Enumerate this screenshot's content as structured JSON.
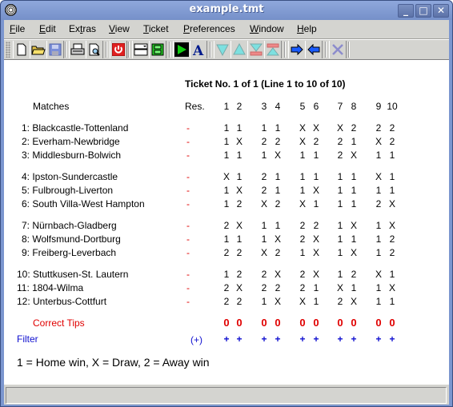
{
  "window": {
    "title": "example.tmt",
    "minimize": "_",
    "maximize": "□",
    "close": "✕"
  },
  "menu": [
    "File",
    "Edit",
    "Extras",
    "View",
    "Ticket",
    "Preferences",
    "Window",
    "Help"
  ],
  "menu_mnemonics": [
    "F",
    "E",
    "t",
    "V",
    "T",
    "P",
    "W",
    "H"
  ],
  "toolbar": [
    {
      "name": "new-document-icon"
    },
    {
      "name": "open-folder-icon"
    },
    {
      "name": "save-disk-icon"
    },
    {
      "name": "print-icon"
    },
    {
      "name": "print-preview-icon"
    },
    {
      "name": "power-exit-icon"
    },
    {
      "name": "window-dropdown-icon"
    },
    {
      "name": "film-frame-icon"
    },
    {
      "name": "play-evaluate-icon"
    },
    {
      "name": "font-a-icon"
    },
    {
      "name": "triangle-down-icon"
    },
    {
      "name": "triangle-up-icon"
    },
    {
      "name": "move-bottom-icon"
    },
    {
      "name": "move-top-icon"
    },
    {
      "name": "arrow-right-icon"
    },
    {
      "name": "arrow-left-icon"
    },
    {
      "name": "delete-x-icon"
    }
  ],
  "ticket": {
    "heading": "Ticket No. 1 of 1 (Line 1 to 10 of 10)",
    "matches_header": "Matches",
    "res_header": "Res.",
    "columns": [
      "1",
      "2",
      "3",
      "4",
      "5",
      "6",
      "7",
      "8",
      "9",
      "10"
    ],
    "matches": [
      {
        "label": "1: Blackcastle-Tottenland",
        "res": "-",
        "tips": [
          "1",
          "1",
          "1",
          "1",
          "X",
          "X",
          "X",
          "2",
          "2",
          "2"
        ]
      },
      {
        "label": "2: Everham-Newbridge",
        "res": "-",
        "tips": [
          "1",
          "X",
          "2",
          "2",
          "X",
          "2",
          "2",
          "1",
          "X",
          "2"
        ]
      },
      {
        "label": "3: Middlesburn-Bolwich",
        "res": "-",
        "tips": [
          "1",
          "1",
          "1",
          "X",
          "1",
          "1",
          "2",
          "X",
          "1",
          "1"
        ]
      },
      {
        "label": "4: Ipston-Sundercastle",
        "res": "-",
        "tips": [
          "X",
          "1",
          "2",
          "1",
          "1",
          "1",
          "1",
          "1",
          "X",
          "1"
        ]
      },
      {
        "label": "5: Fulbrough-Liverton",
        "res": "-",
        "tips": [
          "1",
          "X",
          "2",
          "1",
          "1",
          "X",
          "1",
          "1",
          "1",
          "1"
        ]
      },
      {
        "label": "6: South Villa-West Hampton",
        "res": "-",
        "tips": [
          "1",
          "2",
          "X",
          "2",
          "X",
          "1",
          "1",
          "1",
          "2",
          "X"
        ]
      },
      {
        "label": "7: Nürnbach-Gladberg",
        "res": "-",
        "tips": [
          "2",
          "X",
          "1",
          "1",
          "2",
          "2",
          "1",
          "X",
          "1",
          "X"
        ]
      },
      {
        "label": "8: Wolfsmund-Dortburg",
        "res": "-",
        "tips": [
          "1",
          "1",
          "1",
          "X",
          "2",
          "X",
          "1",
          "1",
          "1",
          "2"
        ]
      },
      {
        "label": "9: Freiberg-Leverbach",
        "res": "-",
        "tips": [
          "2",
          "2",
          "X",
          "2",
          "1",
          "X",
          "1",
          "X",
          "1",
          "2"
        ]
      },
      {
        "label": "10: Stuttkusen-St. Lautern",
        "res": "-",
        "tips": [
          "1",
          "2",
          "2",
          "X",
          "2",
          "X",
          "1",
          "2",
          "X",
          "1"
        ]
      },
      {
        "label": "11: 1804-Wilma",
        "res": "-",
        "tips": [
          "2",
          "X",
          "2",
          "2",
          "2",
          "1",
          "X",
          "1",
          "1",
          "X"
        ]
      },
      {
        "label": "12: Unterbus-Cottfurt",
        "res": "-",
        "tips": [
          "2",
          "2",
          "1",
          "X",
          "X",
          "1",
          "2",
          "X",
          "1",
          "1"
        ]
      }
    ],
    "correct_tips_label": "Correct Tips",
    "correct_tips": [
      "0",
      "0",
      "0",
      "0",
      "0",
      "0",
      "0",
      "0",
      "0",
      "0"
    ],
    "filter_label": "Filter",
    "filter_res": "(+)",
    "filter": [
      "+",
      "+",
      "+",
      "+",
      "+",
      "+",
      "+",
      "+",
      "+",
      "+"
    ],
    "legend": "1 = Home win, X = Draw, 2 =  Away win"
  },
  "status": {
    "text": ""
  }
}
